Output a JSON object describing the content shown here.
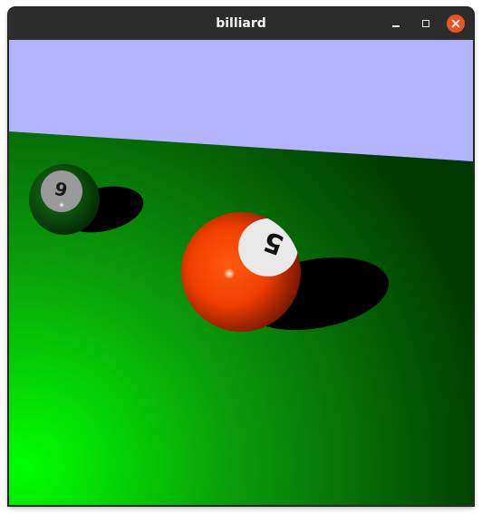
{
  "window": {
    "title": "billiard"
  },
  "controls": {
    "minimize": "minimize",
    "maximize": "maximize",
    "close": "close"
  },
  "scene": {
    "sky_color": "#b3b3ff",
    "table_color_far": "#003a00",
    "table_color_near": "#00ff00",
    "balls": [
      {
        "label": "9",
        "color": "#0b4a0b"
      },
      {
        "label": "5",
        "color": "#ff4a00"
      }
    ]
  }
}
